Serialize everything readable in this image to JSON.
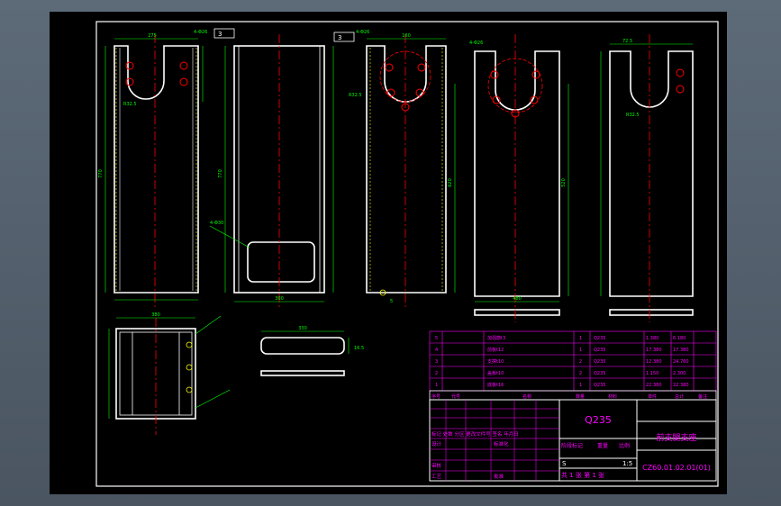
{
  "colors": {
    "background": "#000000",
    "outline": "#ffffff",
    "dimension": "#00ff00",
    "centerline": "#ff0000",
    "hatch": "#ffff00",
    "tableLines": "#ff00ff",
    "tableText": "#ff00ff",
    "tableFrame": "#ffffff"
  },
  "notes": {
    "roughnessA": "3",
    "roughnessB": "3",
    "holesA": "4-Φ26",
    "holesB": "4-Φ26",
    "holesC": "4-Φ26",
    "radius1": "R32.5",
    "radius2": "R32.5",
    "radius3": "R32.5",
    "slotNote": "4-Φ30",
    "weldNote": "5"
  },
  "dims": {
    "topWidth1": "275",
    "topWidth2": "160",
    "topWidth3": "72.5",
    "topWidth4": "72.5",
    "height1": "770",
    "height2": "770",
    "height3": "620",
    "height4": "520",
    "bottomWidth1": "380",
    "bottomWidth2": "300",
    "bottomWidth3": "480",
    "plateWidth": "330",
    "plateThick": "16.5",
    "sideLen": "200"
  },
  "parts": {
    "rows": [
      {
        "no": "5",
        "name": "加强筋t3",
        "qty": "1",
        "mat": "Q235",
        "unit": "1.380",
        "total": "6.180"
      },
      {
        "no": "4",
        "name": "前板t12",
        "qty": "1",
        "mat": "Q235",
        "unit": "17.380",
        "total": "17.380"
      },
      {
        "no": "3",
        "name": "支撑t10",
        "qty": "2",
        "mat": "Q235",
        "unit": "12.380",
        "total": "24.760"
      },
      {
        "no": "2",
        "name": "盖板t10",
        "qty": "2",
        "mat": "Q235",
        "unit": "1.150",
        "total": "2.300"
      },
      {
        "no": "1",
        "name": "底板t16",
        "qty": "1",
        "mat": "Q235",
        "unit": "22.380",
        "total": "22.380"
      }
    ],
    "header": {
      "no": "序号",
      "code": "代号",
      "name": "名称",
      "qty": "数量",
      "mat": "材料",
      "single": "单件",
      "total": "总计",
      "note": "备注"
    }
  },
  "titleBlock": {
    "material": "Q235",
    "partName": "前支腿支座",
    "drawingNo": "CZ60.01.02.01(01)",
    "scale": "1:5",
    "stageLabel": "阶段标记",
    "weightLabel": "重量",
    "scaleLabel": "比例",
    "sheetInfo": "共 1 张 第 1 张",
    "designer": "设计",
    "checker": "审核",
    "approver": "批准",
    "process": "工艺",
    "standard": "标准化",
    "revHeader": "标记 处数 分区 更改文件号 签名 年月日",
    "stageMark": "S"
  }
}
